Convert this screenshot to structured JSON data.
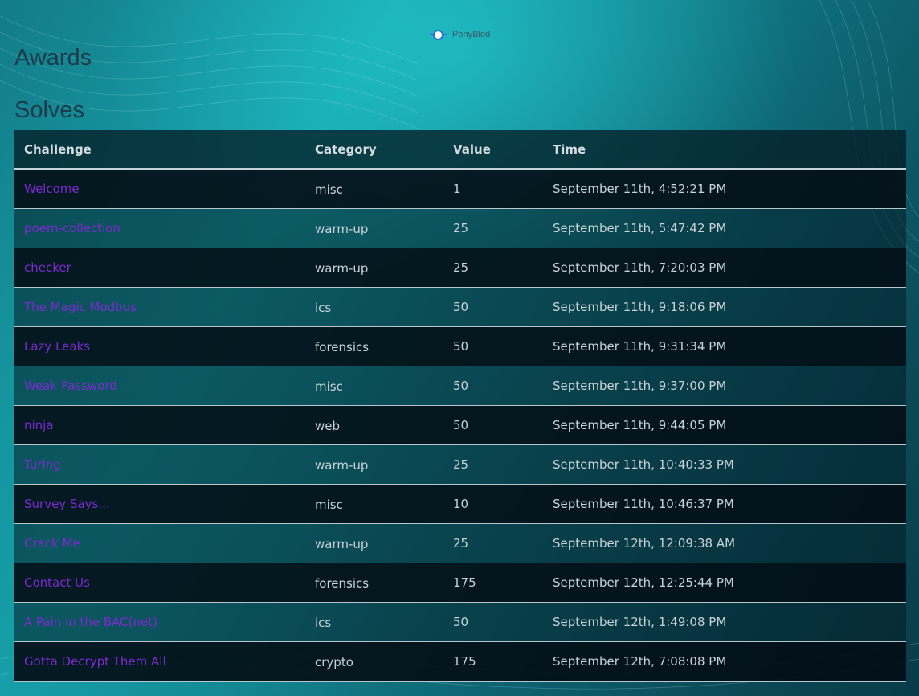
{
  "legend": {
    "label": "PonyBlod"
  },
  "headings": {
    "awards": "Awards",
    "solves": "Solves"
  },
  "table": {
    "columns": [
      "Challenge",
      "Category",
      "Value",
      "Time"
    ],
    "rows": [
      {
        "challenge": "Welcome",
        "category": "misc",
        "value": "1",
        "time": "September 11th, 4:52:21 PM"
      },
      {
        "challenge": "poem-collection",
        "category": "warm-up",
        "value": "25",
        "time": "September 11th, 5:47:42 PM"
      },
      {
        "challenge": "checker",
        "category": "warm-up",
        "value": "25",
        "time": "September 11th, 7:20:03 PM"
      },
      {
        "challenge": "The Magic Modbus",
        "category": "ics",
        "value": "50",
        "time": "September 11th, 9:18:06 PM"
      },
      {
        "challenge": "Lazy Leaks",
        "category": "forensics",
        "value": "50",
        "time": "September 11th, 9:31:34 PM"
      },
      {
        "challenge": "Weak Password",
        "category": "misc",
        "value": "50",
        "time": "September 11th, 9:37:00 PM"
      },
      {
        "challenge": "ninja",
        "category": "web",
        "value": "50",
        "time": "September 11th, 9:44:05 PM"
      },
      {
        "challenge": "Turing",
        "category": "warm-up",
        "value": "25",
        "time": "September 11th, 10:40:33 PM"
      },
      {
        "challenge": "Survey Says...",
        "category": "misc",
        "value": "10",
        "time": "September 11th, 10:46:37 PM"
      },
      {
        "challenge": "Crack Me",
        "category": "warm-up",
        "value": "25",
        "time": "September 12th, 12:09:38 AM"
      },
      {
        "challenge": "Contact Us",
        "category": "forensics",
        "value": "175",
        "time": "September 12th, 12:25:44 PM"
      },
      {
        "challenge": "A Pain in the BAC(net)",
        "category": "ics",
        "value": "50",
        "time": "September 12th, 1:49:08 PM"
      },
      {
        "challenge": "Gotta Decrypt Them All",
        "category": "crypto",
        "value": "175",
        "time": "September 12th, 7:08:08 PM"
      }
    ]
  },
  "colors": {
    "link": "#7c2ad0",
    "legend_line": "#2b6fd6",
    "heading": "#1d3a4a"
  }
}
